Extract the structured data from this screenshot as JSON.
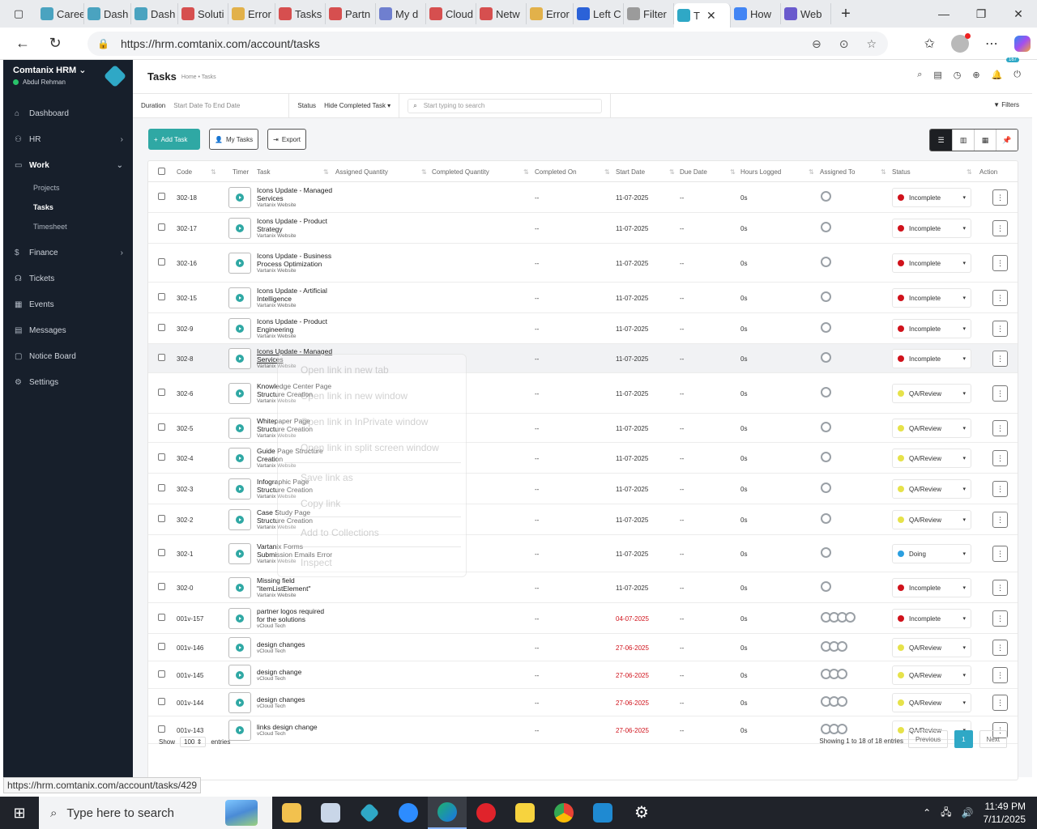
{
  "browser": {
    "tabs": [
      {
        "label": "Caree",
        "color": "#4aa3c0"
      },
      {
        "label": "Dash",
        "color": "#4aa3c0"
      },
      {
        "label": "Dash",
        "color": "#4aa3c0"
      },
      {
        "label": "Soluti",
        "color": "#d64f4f"
      },
      {
        "label": "Error",
        "color": "#e2b14a"
      },
      {
        "label": "Tasks",
        "color": "#d64f4f"
      },
      {
        "label": "Partn",
        "color": "#d64f4f"
      },
      {
        "label": "My d",
        "color": "#6f7fcf"
      },
      {
        "label": "Cloud",
        "color": "#d64f4f"
      },
      {
        "label": "Netw",
        "color": "#d64f4f"
      },
      {
        "label": "Error",
        "color": "#e2b14a"
      },
      {
        "label": "Left C",
        "color": "#2b62d8"
      },
      {
        "label": "Filter",
        "color": "#9b9b9b"
      },
      {
        "label": "T",
        "color": "#2fa8c6"
      },
      {
        "label": "How",
        "color": "#4285f4"
      },
      {
        "label": "Web",
        "color": "#6a5acd"
      }
    ],
    "url": "https://hrm.comtanix.com/account/tasks",
    "status_url": "https://hrm.comtanix.com/account/tasks/429"
  },
  "sidebar": {
    "brand": "Comtanix HRM",
    "user": "Abdul Rehman",
    "items": [
      {
        "label": "Dashboard",
        "icon": "home-icon"
      },
      {
        "label": "HR",
        "icon": "users-icon"
      },
      {
        "label": "Work",
        "icon": "briefcase-icon"
      },
      {
        "label": "Finance",
        "icon": "dollar-icon"
      },
      {
        "label": "Tickets",
        "icon": "headset-icon"
      },
      {
        "label": "Events",
        "icon": "calendar-icon"
      },
      {
        "label": "Messages",
        "icon": "message-icon"
      },
      {
        "label": "Notice Board",
        "icon": "clipboard-icon"
      },
      {
        "label": "Settings",
        "icon": "gear-icon"
      }
    ],
    "work_sub": [
      "Projects",
      "Tasks",
      "Timesheet"
    ]
  },
  "header": {
    "title": "Tasks",
    "breadcrumb": "Home • Tasks",
    "notif_count": "167"
  },
  "filters": {
    "duration_label": "Duration",
    "duration_value": "Start Date To End Date",
    "status_label": "Status",
    "status_value": "Hide Completed Task",
    "search_placeholder": "Start typing to search",
    "filters_label": "Filters"
  },
  "actions": {
    "add": "Add Task",
    "my_tasks": "My Tasks",
    "export": "Export"
  },
  "table": {
    "columns": [
      "Code",
      "Timer",
      "Task",
      "Assigned Quantity",
      "Completed Quantity",
      "Completed On",
      "Start Date",
      "Due Date",
      "Hours Logged",
      "Assigned To",
      "Status",
      "Action"
    ],
    "rows": [
      {
        "code": "302-18",
        "task": "Icons Update - Managed Services",
        "project": "Vartanix Website",
        "completed_on": "--",
        "start": "11-07-2025",
        "due": "--",
        "hours": "0s",
        "assignees": 1,
        "status": "Incomplete",
        "late": false
      },
      {
        "code": "302-17",
        "task": "Icons Update - Product Strategy",
        "project": "Vartanix Website",
        "completed_on": "--",
        "start": "11-07-2025",
        "due": "--",
        "hours": "0s",
        "assignees": 1,
        "status": "Incomplete",
        "late": false
      },
      {
        "code": "302-16",
        "task": "Icons Update - Business Process Optimization",
        "project": "Vartanix Website",
        "completed_on": "--",
        "start": "11-07-2025",
        "due": "--",
        "hours": "0s",
        "assignees": 1,
        "status": "Incomplete",
        "late": false
      },
      {
        "code": "302-15",
        "task": "Icons Update - Artificial Intelligence",
        "project": "Vartanix Website",
        "completed_on": "--",
        "start": "11-07-2025",
        "due": "--",
        "hours": "0s",
        "assignees": 1,
        "status": "Incomplete",
        "late": false
      },
      {
        "code": "302-9",
        "task": "Icons Update - Product Engineering",
        "project": "Vartanix Website",
        "completed_on": "--",
        "start": "11-07-2025",
        "due": "--",
        "hours": "0s",
        "assignees": 1,
        "status": "Incomplete",
        "late": false
      },
      {
        "code": "302-8",
        "task": "Icons Update - Managed Services",
        "project": "Vartanix Website",
        "completed_on": "--",
        "start": "11-07-2025",
        "due": "--",
        "hours": "0s",
        "assignees": 1,
        "status": "Incomplete",
        "late": false
      },
      {
        "code": "302-6",
        "task": "Knowledge Center Page Structure Creation",
        "project": "Vartanix Website",
        "completed_on": "--",
        "start": "11-07-2025",
        "due": "--",
        "hours": "0s",
        "assignees": 1,
        "status": "QA/Review",
        "late": false
      },
      {
        "code": "302-5",
        "task": "Whitepaper Page Structure Creation",
        "project": "Vartanix Website",
        "completed_on": "--",
        "start": "11-07-2025",
        "due": "--",
        "hours": "0s",
        "assignees": 1,
        "status": "QA/Review",
        "late": false
      },
      {
        "code": "302-4",
        "task": "Guide Page Structure Creation",
        "project": "Vartanix Website",
        "completed_on": "--",
        "start": "11-07-2025",
        "due": "--",
        "hours": "0s",
        "assignees": 1,
        "status": "QA/Review",
        "late": false
      },
      {
        "code": "302-3",
        "task": "Infographic Page Structure Creation",
        "project": "Vartanix Website",
        "completed_on": "--",
        "start": "11-07-2025",
        "due": "--",
        "hours": "0s",
        "assignees": 1,
        "status": "QA/Review",
        "late": false
      },
      {
        "code": "302-2",
        "task": "Case Study Page Structure Creation",
        "project": "Vartanix Website",
        "completed_on": "--",
        "start": "11-07-2025",
        "due": "--",
        "hours": "0s",
        "assignees": 1,
        "status": "QA/Review",
        "late": false
      },
      {
        "code": "302-1",
        "task": "Vartanix Forms Submission Emails Error",
        "project": "Vartanix Website",
        "completed_on": "--",
        "start": "11-07-2025",
        "due": "--",
        "hours": "0s",
        "assignees": 1,
        "status": "Doing",
        "late": false
      },
      {
        "code": "302-0",
        "task": "Missing field \"itemListElement\"",
        "project": "Vartanix Website",
        "completed_on": "--",
        "start": "11-07-2025",
        "due": "--",
        "hours": "0s",
        "assignees": 1,
        "status": "Incomplete",
        "late": false
      },
      {
        "code": "001v-157",
        "task": "partner logos required for the solutions",
        "project": "vCloud Tech",
        "completed_on": "--",
        "start": "04-07-2025",
        "due": "--",
        "hours": "0s",
        "assignees": 4,
        "status": "Incomplete",
        "late": true
      },
      {
        "code": "001v-146",
        "task": "design changes",
        "project": "vCloud Tech",
        "completed_on": "--",
        "start": "27-06-2025",
        "due": "--",
        "hours": "0s",
        "assignees": 3,
        "status": "QA/Review",
        "late": true
      },
      {
        "code": "001v-145",
        "task": "design change",
        "project": "vCloud Tech",
        "completed_on": "--",
        "start": "27-06-2025",
        "due": "--",
        "hours": "0s",
        "assignees": 3,
        "status": "QA/Review",
        "late": true
      },
      {
        "code": "001v-144",
        "task": "design changes",
        "project": "vCloud Tech",
        "completed_on": "--",
        "start": "27-06-2025",
        "due": "--",
        "hours": "0s",
        "assignees": 3,
        "status": "QA/Review",
        "late": true
      },
      {
        "code": "001v-143",
        "task": "links design change",
        "project": "vCloud Tech",
        "completed_on": "--",
        "start": "27-06-2025",
        "due": "--",
        "hours": "0s",
        "assignees": 3,
        "status": "QA/Review",
        "late": true
      }
    ],
    "status_colors": {
      "Incomplete": "#d0121b",
      "QA/Review": "#e6e24a",
      "Doing": "#2b9fe0"
    },
    "show_label": "Show",
    "per_page": "100",
    "entries_label": "entries",
    "info": "Showing 1 to 18 of 18 entries",
    "prev": "Previous",
    "page": "1",
    "next": "Next"
  },
  "context_menu": [
    "Open link in new tab",
    "Open link in new window",
    "Open link in InPrivate window",
    "Open link in split screen window",
    "Save link as",
    "Copy link",
    "Add to Collections",
    "Inspect"
  ],
  "taskbar": {
    "search_placeholder": "Type here to search",
    "time": "11:49 PM",
    "date": "7/11/2025"
  }
}
